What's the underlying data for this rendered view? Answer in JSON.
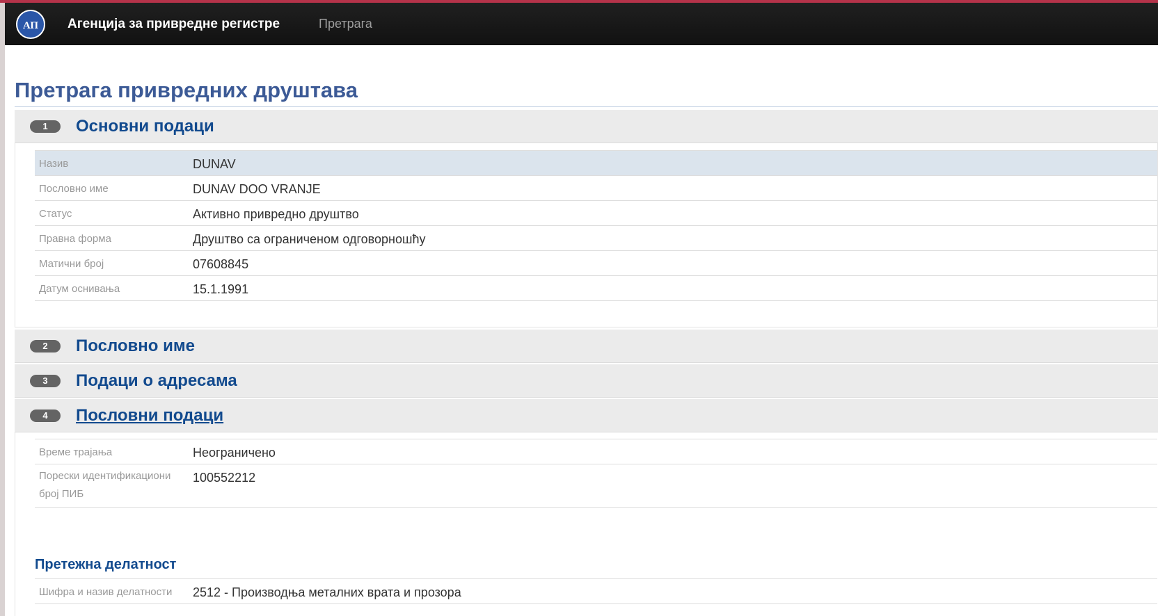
{
  "header": {
    "agency_name": "Агенција за привредне регистре",
    "nav_search": "Претрага",
    "logo_text": "АПР"
  },
  "page": {
    "title": "Претрага привредних друштава"
  },
  "panels": [
    {
      "number": "1",
      "title": "Основни подаци"
    },
    {
      "number": "2",
      "title": "Пословно име"
    },
    {
      "number": "3",
      "title": "Подаци о адресама"
    },
    {
      "number": "4",
      "title": "Пословни подаци"
    }
  ],
  "basic_data": [
    {
      "label": "Назив",
      "value": "DUNAV"
    },
    {
      "label": "Пословно име",
      "value": "DUNAV DOO VRANJE"
    },
    {
      "label": "Статус",
      "value": "Активно привредно друштво"
    },
    {
      "label": "Правна форма",
      "value": "Друштво са ограниченом одговорношћу"
    },
    {
      "label": "Матични број",
      "value": "07608845"
    },
    {
      "label": "Датум оснивања",
      "value": "15.1.1991"
    }
  ],
  "business_data": [
    {
      "label": "Време трајања",
      "value": "Неограничено"
    },
    {
      "label": "Порески идентификациони број ПИБ",
      "value": "100552212"
    }
  ],
  "activity": {
    "heading": "Претежна делатност",
    "label": "Шифра и назив делатности",
    "value": "2512 - Производња металних врата и прозора"
  },
  "colors": {
    "accent": "#b5334a",
    "navbar": "#111111",
    "title": "#3c5a96",
    "panel_title": "#124a8e",
    "highlight_row": "#dbe4ed"
  }
}
